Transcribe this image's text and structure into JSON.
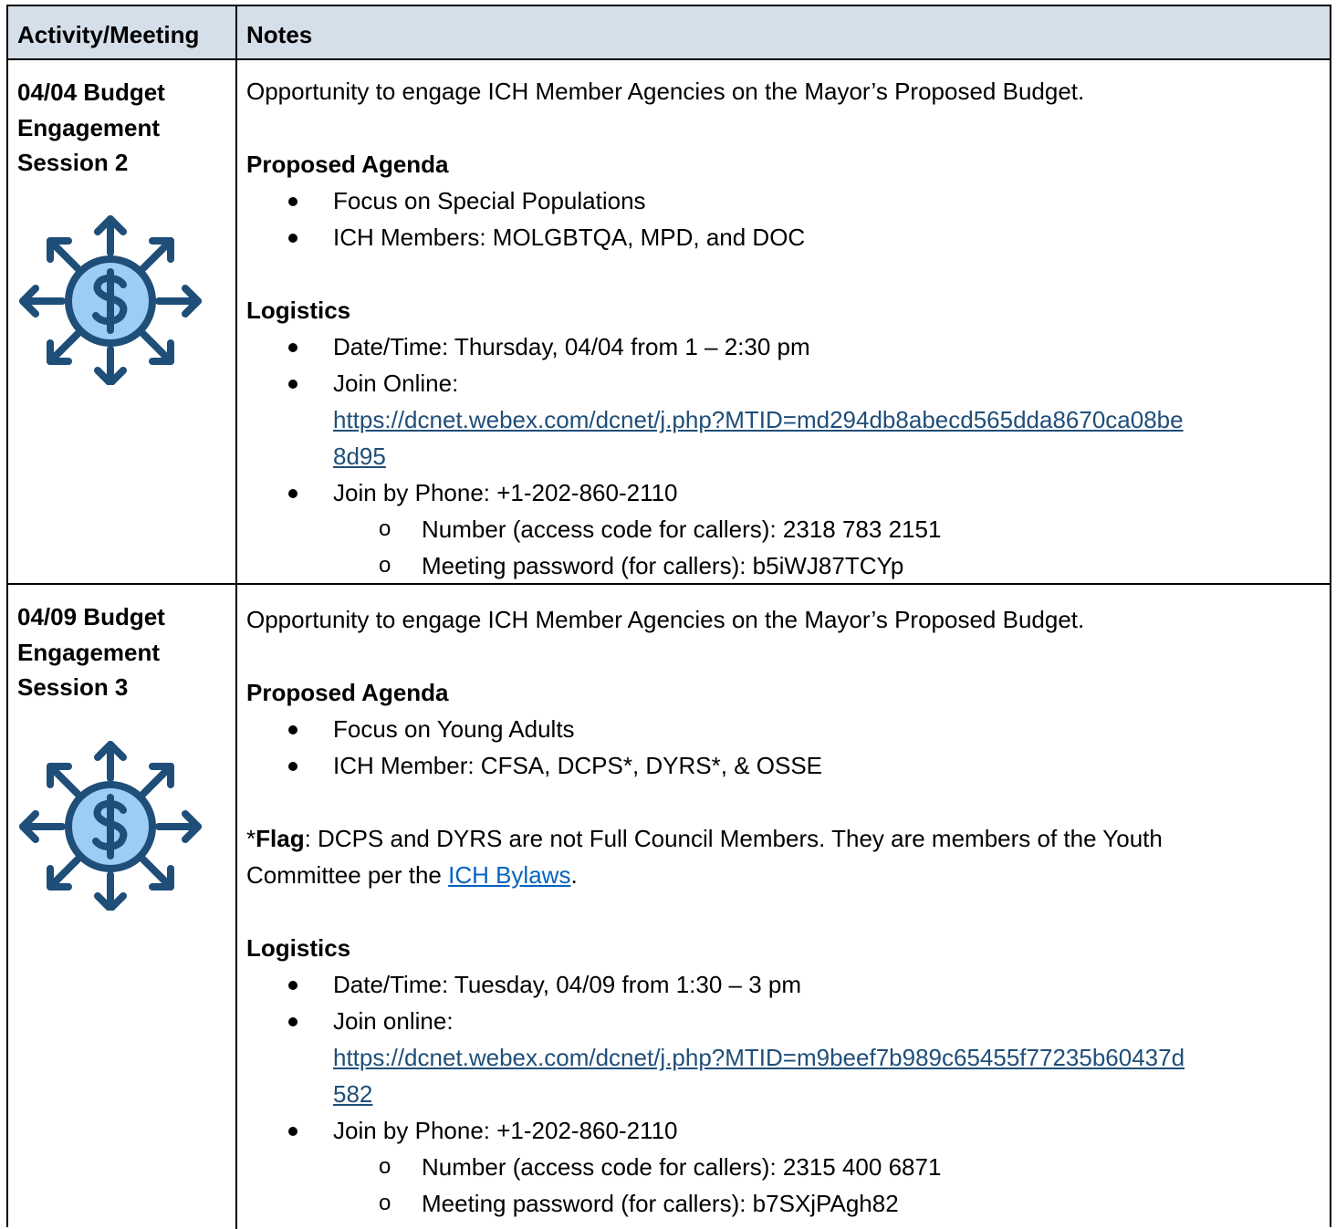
{
  "header": {
    "col1": "Activity/Meeting",
    "col2": "Notes"
  },
  "rows": [
    {
      "title_lines": [
        "04/04 Budget",
        "Engagement",
        "Session 2"
      ],
      "icon": "money-distribution-icon",
      "intro": "Opportunity to engage ICH Member Agencies on the Mayor’s Proposed Budget.",
      "agenda_heading": "Proposed Agenda",
      "agenda_items": [
        "Focus on Special Populations",
        "ICH Members: MOLGBTQA, MPD, and DOC"
      ],
      "logistics_heading": "Logistics",
      "datetime": "Date/Time: Thursday, 04/04 from 1 – 2:30 pm",
      "join_online_label": "Join Online:",
      "url_line1": "https://dcnet.webex.com/dcnet/j.php?MTID=md294db8abecd565dda8670ca08be",
      "url_line2": "8d95",
      "phone": "Join by Phone: +1-202-860-2110",
      "sub_marker": "o",
      "access_code": "Number (access code for callers): 2318 783 2151",
      "password": "Meeting password (for callers): b5iWJ87TCYp"
    },
    {
      "title_lines": [
        "04/09 Budget",
        "Engagement",
        "Session 3"
      ],
      "icon": "money-distribution-icon",
      "intro": "Opportunity to engage ICH Member Agencies on the Mayor’s Proposed Budget.",
      "agenda_heading": "Proposed Agenda",
      "agenda_items": [
        "Focus on Young Adults",
        "ICH Member: CFSA, DCPS*, DYRS*, & OSSE"
      ],
      "flag_star": "*",
      "flag_word": "Flag",
      "flag_text1": ": DCPS and DYRS are not Full Council Members.  They are members of the Youth",
      "flag_text2": "Committee per the ",
      "flag_link": "ICH Bylaws",
      "flag_end": ".",
      "logistics_heading": "Logistics",
      "datetime": "Date/Time: Tuesday, 04/09 from 1:30 – 3 pm",
      "join_online_label": "Join online:",
      "url_line1": "https://dcnet.webex.com/dcnet/j.php?MTID=m9beef7b989c65455f77235b60437d",
      "url_line2": "582",
      "phone": "Join by Phone: +1-202-860-2110",
      "sub_marker": "o",
      "access_code": "Number (access code for callers): 2315 400 6871",
      "password": "Meeting password (for callers): b7SXjPAgh82"
    }
  ],
  "colors": {
    "header_bg": "#d4dfe9",
    "icon_dark": "#1f4e79",
    "icon_light": "#9dcdf5",
    "url": "#1f4e79",
    "doc_link": "#0563c1"
  }
}
